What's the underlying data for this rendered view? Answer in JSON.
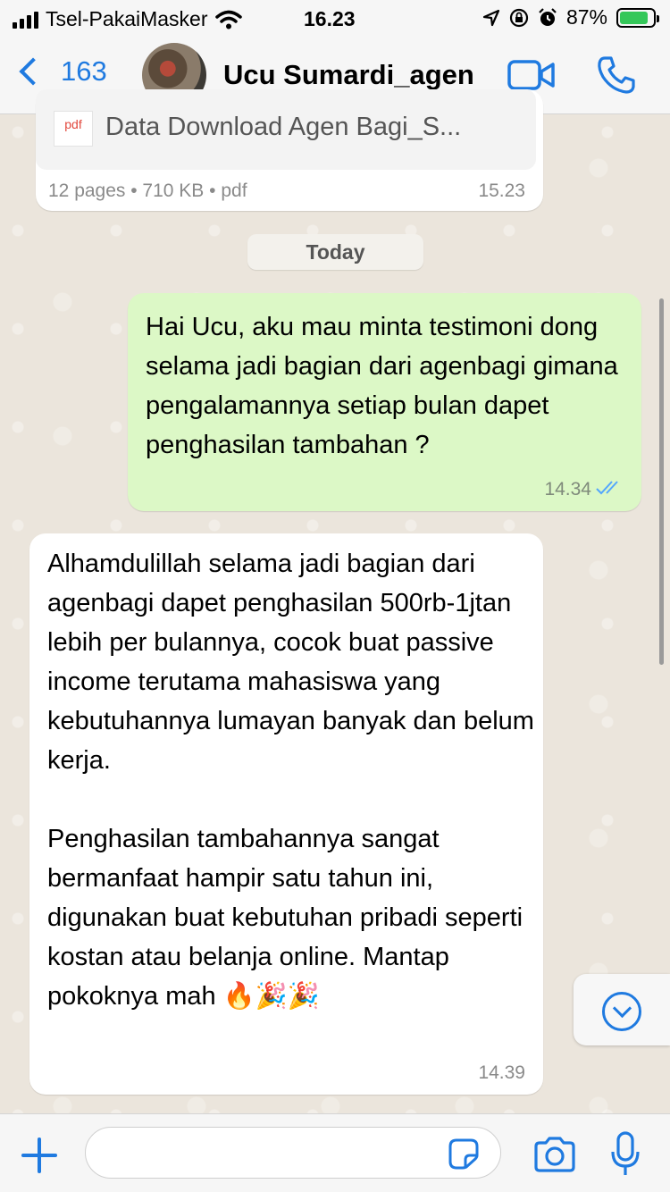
{
  "status_bar": {
    "carrier": "Tsel-PakaiMasker",
    "time": "16.23",
    "battery": "87%"
  },
  "header": {
    "back_count": "163",
    "contact_name": "Ucu Sumardi_agen"
  },
  "document_message": {
    "file_name": "Data Download Agen Bagi_S...",
    "file_type_badge": "pdf",
    "meta": "12 pages • 710 KB • pdf",
    "time": "15.23"
  },
  "date_separator": "Today",
  "outgoing_message": {
    "text": "Hai Ucu, aku mau minta testimoni dong selama jadi bagian dari agenbagi gimana pengalamannya setiap bulan dapet penghasilan tambahan ?",
    "time": "14.34"
  },
  "incoming_message": {
    "text": "Alhamdulillah selama jadi bagian dari agenbagi dapet penghasilan 500rb-1jtan lebih per bulannya, cocok buat passive income terutama mahasiswa yang kebutuhannya lumayan banyak dan belum kerja.\n\nPenghasilan tambahannya sangat bermanfaat hampir satu tahun ini, digunakan buat kebutuhan pribadi seperti kostan atau belanja online. Mantap pokoknya mah 🔥🎉🎉",
    "time": "14.39"
  },
  "composer": {
    "placeholder": ""
  },
  "colors": {
    "accent": "#1f7ae0",
    "outgoing_bubble": "#dcf8c6",
    "incoming_bubble": "#ffffff",
    "battery": "#34c759"
  },
  "icons": [
    "signal-icon",
    "wifi-icon",
    "location-icon",
    "lock-rotation-icon",
    "alarm-icon",
    "battery-icon",
    "back-chevron-icon",
    "video-call-icon",
    "phone-call-icon",
    "pdf-icon",
    "read-ticks-icon",
    "scroll-down-icon",
    "plus-icon",
    "sticker-icon",
    "camera-icon",
    "mic-icon"
  ]
}
